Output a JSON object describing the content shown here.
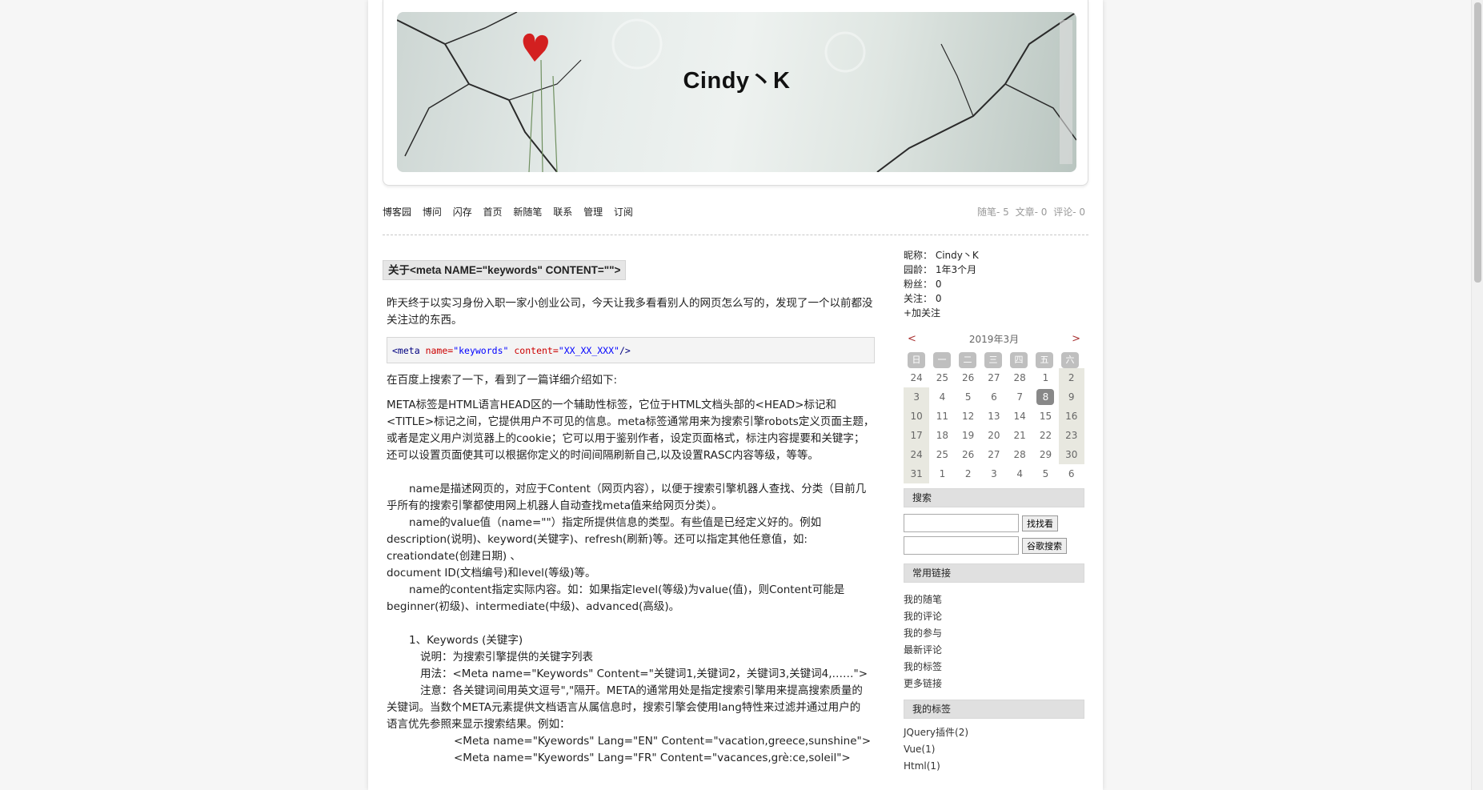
{
  "header": {
    "title": "Cindy丶K"
  },
  "nav": {
    "items": [
      "博客园",
      "博问",
      "闪存",
      "首页",
      "新随笔",
      "联系",
      "管理",
      "订阅"
    ]
  },
  "stats": {
    "posts": "随笔- 5",
    "articles": "文章- 0",
    "comments": "评论- 0"
  },
  "post": {
    "title": "关于<meta NAME=\"keywords\" CONTENT=\"\">",
    "intro": "昨天终于以实习身份入职一家小创业公司，今天让我多看看别人的网页怎么写的，发现了一个以前都没关注过的东西。",
    "code": {
      "tag_open": "<meta",
      "attr1": "name=",
      "val1": "\"keywords\"",
      "attr2": "content=",
      "val2": "\"XX_XX_XXX\"",
      "tag_close": "/>"
    },
    "search_line": "在百度上搜索了一下，看到了一篇详细介绍如下:",
    "meta_desc_1": " META标签是HTML语言HEAD区的一个辅助性标签，它位于HTML文档头部的<HEAD>标记和",
    "meta_desc_2": "<TITLE>标记之间，它提供用户不可见的信息。meta标签通常用来为搜索引擎robots定义页面主题，",
    "meta_desc_3": "或者是定义用户浏览器上的cookie；它可以用于鉴别作者，设定页面格式，标注内容提要和关键字；",
    "meta_desc_4": "还可以设置页面使其可以根据你定义的时间间隔刷新自己,以及设置RASC内容等级，等等。",
    "name1_a": "name是描述网页的，对应于Content（网页内容），以便于搜索引擎机器人查找、分类（目前几",
    "name1_b": "乎所有的搜索引擎都使用网上机器人自动查找meta值来给网页分类）。",
    "name2_a": "name的value值（name=\"\"）指定所提供信息的类型。有些值是已经定义好的。例如",
    "name2_b": "description(说明)、keyword(关键字)、refresh(刷新)等。还可以指定其他任意值，如:",
    "name2_c": "creationdate(创建日期) 、",
    "name2_d": "document ID(文档编号)和level(等级)等。",
    "name3_a": "name的content指定实际内容。如：如果指定level(等级)为value(值)，则Content可能是",
    "name3_b": "beginner(初级)、intermediate(中级)、advanced(高级)。",
    "kw_title": "1、Keywords (关键字)",
    "kw_desc": "说明：为搜索引擎提供的关键字列表",
    "kw_usage": "用法：<Meta name=\"Keywords\" Content=\"关键词1,关键词2，关键词3,关键词4,……\">",
    "kw_note_a": "注意：各关键词间用英文逗号\",\"隔开。META的通常用处是指定搜索引擎用来提高搜索质量的",
    "kw_note_b": "关键词。当数个META元素提供文档语言从属信息时，搜索引擎会使用lang特性来过滤并通过用户的",
    "kw_note_c": "语言优先参照来显示搜索结果。例如：",
    "kw_ex1": "<Meta name=\"Kyewords\" Lang=\"EN\" Content=\"vacation,greece,sunshine\">",
    "kw_ex2": "<Meta name=\"Kyewords\" Lang=\"FR\" Content=\"vacances,grè:ce,soleil\">"
  },
  "sidebar": {
    "nickname": "昵称：  Cindy丶K",
    "age": "园龄：  1年3个月",
    "fans": "粉丝：  0",
    "follow": "关注：  0",
    "add_follow": "+加关注",
    "calendar": {
      "prev": "<",
      "next": ">",
      "title": "2019年3月",
      "weekdays": [
        "日",
        "一",
        "二",
        "三",
        "四",
        "五",
        "六"
      ],
      "rows": [
        [
          "24",
          "25",
          "26",
          "27",
          "28",
          "1",
          "2"
        ],
        [
          "3",
          "4",
          "5",
          "6",
          "7",
          "8",
          "9"
        ],
        [
          "10",
          "11",
          "12",
          "13",
          "14",
          "15",
          "16"
        ],
        [
          "17",
          "18",
          "19",
          "20",
          "21",
          "22",
          "23"
        ],
        [
          "24",
          "25",
          "26",
          "27",
          "28",
          "29",
          "30"
        ],
        [
          "31",
          "1",
          "2",
          "3",
          "4",
          "5",
          "6"
        ]
      ],
      "today": "8"
    },
    "search_title": "搜索",
    "search_btn": "找找看",
    "google_btn": "谷歌搜索",
    "links_title": "常用链接",
    "links": [
      "我的随笔",
      "我的评论",
      "我的参与",
      "最新评论",
      "我的标签",
      "更多链接"
    ],
    "tags_title": "我的标签",
    "tags": [
      "JQuery插件(2)",
      "Vue(1)",
      "Html(1)"
    ]
  }
}
